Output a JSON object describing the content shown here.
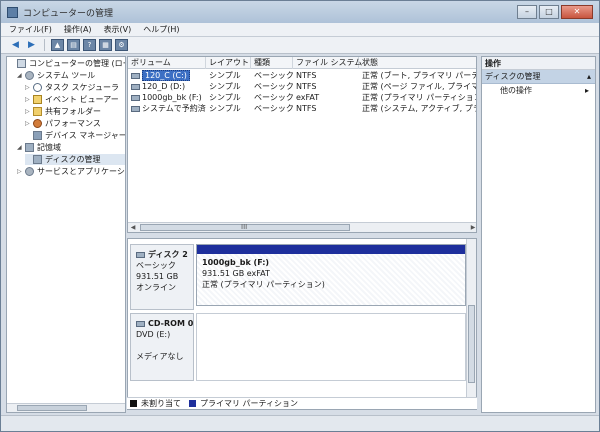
{
  "window": {
    "title": "コンピューターの管理",
    "buttons": {
      "minimize": "–",
      "maximize": "□",
      "close": "✕"
    }
  },
  "menu": [
    "ファイル(F)",
    "操作(A)",
    "表示(V)",
    "ヘルプ(H)"
  ],
  "tree": {
    "items": [
      {
        "label": "コンピューターの管理 (ローカ",
        "level": 0,
        "expander": "",
        "icon": "computer-icon"
      },
      {
        "label": "システム ツール",
        "level": 1,
        "expander": "◢",
        "icon": "tools-icon"
      },
      {
        "label": "タスク スケジューラ",
        "level": 2,
        "expander": "▷",
        "icon": "clock-icon"
      },
      {
        "label": "イベント ビューアー",
        "level": 2,
        "expander": "▷",
        "icon": "event-icon"
      },
      {
        "label": "共有フォルダー",
        "level": 2,
        "expander": "▷",
        "icon": "folder-icon"
      },
      {
        "label": "パフォーマンス",
        "level": 2,
        "expander": "▷",
        "icon": "performance-icon"
      },
      {
        "label": "デバイス マネージャー",
        "level": 2,
        "expander": "",
        "icon": "device-manager-icon"
      },
      {
        "label": "記憶域",
        "level": 1,
        "expander": "◢",
        "icon": "storage-icon"
      },
      {
        "label": "ディスクの管理",
        "level": 2,
        "expander": "",
        "icon": "disk-icon",
        "selected": true
      },
      {
        "label": "サービスとアプリケーション",
        "level": 1,
        "expander": "▷",
        "icon": "services-icon"
      }
    ]
  },
  "volumes": {
    "columns": [
      "ボリューム",
      "レイアウト",
      "種類",
      "ファイル システム",
      "状態"
    ],
    "rows": [
      [
        "120_C (C:)",
        "シンプル",
        "ベーシック",
        "NTFS",
        "正常 (ブート, プライマリ パーティシ"
      ],
      [
        "120_D (D:)",
        "シンプル",
        "ベーシック",
        "NTFS",
        "正常 (ページ ファイル, プライマリ パ"
      ],
      [
        "1000gb_bk (F:)",
        "シンプル",
        "ベーシック",
        "exFAT",
        "正常 (プライマリ パーティション)"
      ],
      [
        "システムで予約済み",
        "シンプル",
        "ベーシック",
        "NTFS",
        "正常 (システム, アクティブ, プライマ"
      ]
    ]
  },
  "disks": [
    {
      "name": "ディスク 2",
      "type": "ベーシック",
      "size": "931.51 GB",
      "status": "オンライン",
      "partition": {
        "label": "1000gb_bk  (F:)",
        "size_fs": "931.51 GB exFAT",
        "status": "正常 (プライマリ パーティション)"
      }
    },
    {
      "name": "CD-ROM 0",
      "type": "DVD (E:)",
      "size": "",
      "status": "メディアなし"
    }
  ],
  "legend": [
    {
      "label": "未割り当て",
      "color": "#111111"
    },
    {
      "label": "プライマリ パーティション",
      "color": "#1e2f9c"
    }
  ],
  "actions": {
    "title": "操作",
    "section": "ディスクの管理",
    "items": [
      "他の操作"
    ]
  },
  "scroll_grip": "III"
}
